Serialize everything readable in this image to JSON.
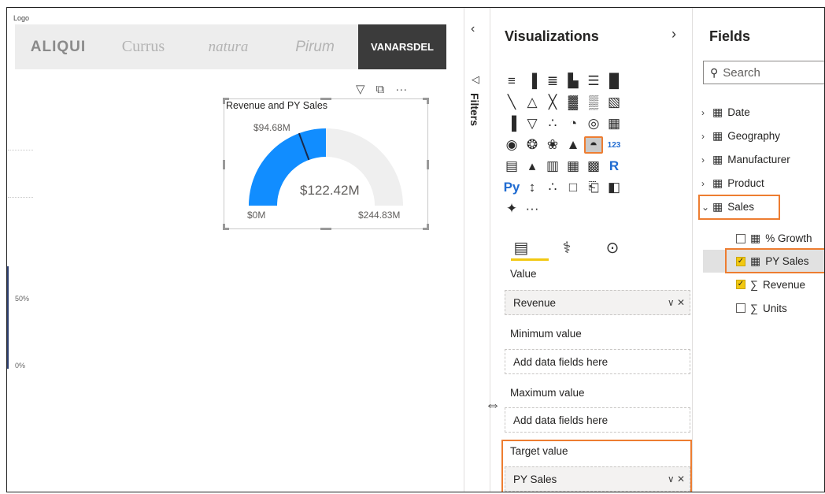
{
  "canvas": {
    "logo_caption": "Logo",
    "logos": [
      "ALIQUI",
      "Currus",
      "natura",
      "Pirum",
      "VANARSDEL"
    ],
    "axis_labels": [
      "50%",
      "0%"
    ],
    "visual_header_icons": [
      "filter-icon",
      "focus-mode-icon",
      "more-options-icon"
    ],
    "visual_header_glyphs": [
      "▽",
      "⧉",
      "···"
    ],
    "gauge": {
      "title": "Revenue and PY Sales",
      "value_label": "$122.42M",
      "target_label": "$94.68M",
      "min_label": "$0M",
      "max_label": "$244.83M",
      "value": 122.42,
      "target": 94.68,
      "min": 0,
      "max": 244.83,
      "fill_color": "#118dff",
      "track_color": "#efefef",
      "target_color": "#1b2a4a"
    }
  },
  "filters_pane": {
    "collapse_glyph": "‹",
    "funnel_glyph": "◁",
    "label": "Filters"
  },
  "visualizations": {
    "title": "Visualizations",
    "expand_glyph": "›",
    "icon_glyphs": [
      "≡",
      "▐",
      "≣",
      "▙",
      "☰",
      "█",
      "╲",
      "△",
      "╳",
      "▓",
      "▒",
      "▧",
      "▐",
      "▽",
      "∴",
      "◔",
      "◎",
      "▦",
      "◉",
      "❂",
      "❀",
      "▲",
      "◓",
      "123",
      "▤",
      "▴",
      "▥",
      "▦",
      "▩",
      "R",
      "Py",
      "↕",
      "∴",
      "□",
      "⎗",
      "◧",
      "✦",
      "···"
    ],
    "selected_index": 22,
    "subtab_glyphs": [
      "▤",
      "⚕",
      "⊙"
    ],
    "wells": [
      {
        "label": "Value",
        "field": "Revenue",
        "placeholder": ""
      },
      {
        "label": "Minimum value",
        "field": "",
        "placeholder": "Add data fields here"
      },
      {
        "label": "Maximum value",
        "field": "",
        "placeholder": "Add data fields here"
      },
      {
        "label": "Target value",
        "field": "PY Sales",
        "placeholder": ""
      }
    ],
    "well_actions": "∨ ✕"
  },
  "fields": {
    "title": "Fields",
    "search_placeholder": "Search",
    "tables": [
      {
        "name": "Date",
        "expanded": false
      },
      {
        "name": "Geography",
        "expanded": false
      },
      {
        "name": "Manufacturer",
        "expanded": false
      },
      {
        "name": "Product",
        "expanded": false
      },
      {
        "name": "Sales",
        "expanded": true
      }
    ],
    "sales_fields": [
      {
        "name": "% Growth",
        "checked": false,
        "kind": "measure"
      },
      {
        "name": "PY Sales",
        "checked": true,
        "kind": "measure"
      },
      {
        "name": "Revenue",
        "checked": true,
        "kind": "sum"
      },
      {
        "name": "Units",
        "checked": false,
        "kind": "sum"
      }
    ]
  },
  "colors": {
    "highlight": "#ed7d31",
    "accent_yellow": "#f2c811"
  }
}
